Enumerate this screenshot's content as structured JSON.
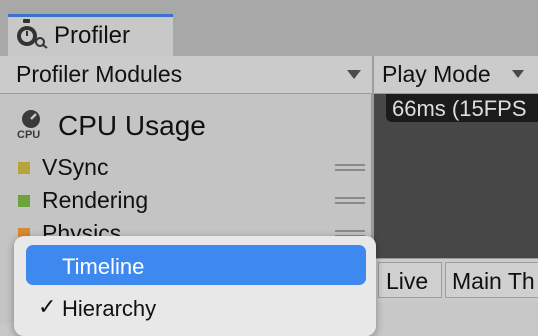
{
  "tab": {
    "title": "Profiler",
    "icon": "profiler-stopwatch-icon"
  },
  "toolbar": {
    "modules_label": "Profiler Modules",
    "playmode_label": "Play Mode"
  },
  "modules": {
    "cpu": {
      "title": "CPU Usage",
      "icon": "cpu-icon",
      "icon_text": "CPU"
    },
    "legend": [
      {
        "label": "VSync",
        "color": "#b8a23a"
      },
      {
        "label": "Rendering",
        "color": "#6da23d"
      },
      {
        "label": "Physics",
        "color": "#d98a2f"
      }
    ]
  },
  "chart": {
    "fps_label": "66ms (15FPS"
  },
  "lower_toolbar": {
    "live_label": "Live",
    "main_thread_label": "Main Th"
  },
  "menu": {
    "items": [
      {
        "label": "Timeline",
        "highlighted": true,
        "checked": false
      },
      {
        "label": "Hierarchy",
        "highlighted": false,
        "checked": true,
        "check_mark": "✓"
      }
    ],
    "highlight_color": "#3e89f0"
  }
}
